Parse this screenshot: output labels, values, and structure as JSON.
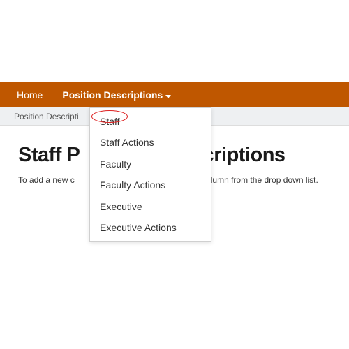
{
  "navbar": {
    "home_label": "Home",
    "position_descriptions_label": "Position Descriptions"
  },
  "breadcrumb": {
    "text": "Position Descripti"
  },
  "page": {
    "title_left": "Staff P",
    "title_right": "escriptions",
    "description_left": "To add a new c",
    "description_right": "s, select the column from the drop down list."
  },
  "dropdown": {
    "items": [
      {
        "label": "Staff"
      },
      {
        "label": "Staff Actions"
      },
      {
        "label": "Faculty"
      },
      {
        "label": "Faculty Actions"
      },
      {
        "label": "Executive"
      },
      {
        "label": "Executive Actions"
      }
    ]
  },
  "colors": {
    "accent": "#bf5700",
    "highlight": "#d22"
  }
}
